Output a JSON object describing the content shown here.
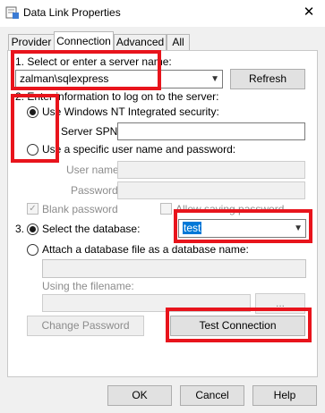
{
  "window": {
    "title": "Data Link Properties",
    "close_glyph": "✕",
    "icon": "data-link-icon"
  },
  "tabs": [
    {
      "label": "Provider",
      "active": false
    },
    {
      "label": "Connection",
      "active": true
    },
    {
      "label": "Advanced",
      "active": false
    },
    {
      "label": "All",
      "active": false
    }
  ],
  "step1": {
    "label": "1. Select or enter a server name:",
    "server_value": "zalman\\sqlexpress",
    "refresh_label": "Refresh"
  },
  "step2": {
    "label": "2. Enter information to log on to the server:",
    "windows_nt_label": "Use Windows NT Integrated security:",
    "server_spn_label": "Server SPN:",
    "server_spn_value": "",
    "specific_user_label": "Use a specific user name and password:",
    "user_name_label": "User name:",
    "password_label": "Password:",
    "blank_password_label": "Blank password",
    "allow_saving_label": "Allow saving password"
  },
  "step3": {
    "number": "3.",
    "select_db_label": "Select the database:",
    "database_value": "test",
    "attach_label": "Attach a database file as a database name:",
    "using_filename_label": "Using the filename:",
    "browse_label": "..."
  },
  "actions": {
    "change_password_label": "Change Password",
    "test_connection_label": "Test Connection"
  },
  "footer": {
    "ok_label": "OK",
    "cancel_label": "Cancel",
    "help_label": "Help"
  },
  "colors": {
    "highlight_red": "#e8141c",
    "selection_blue": "#0078d7"
  }
}
